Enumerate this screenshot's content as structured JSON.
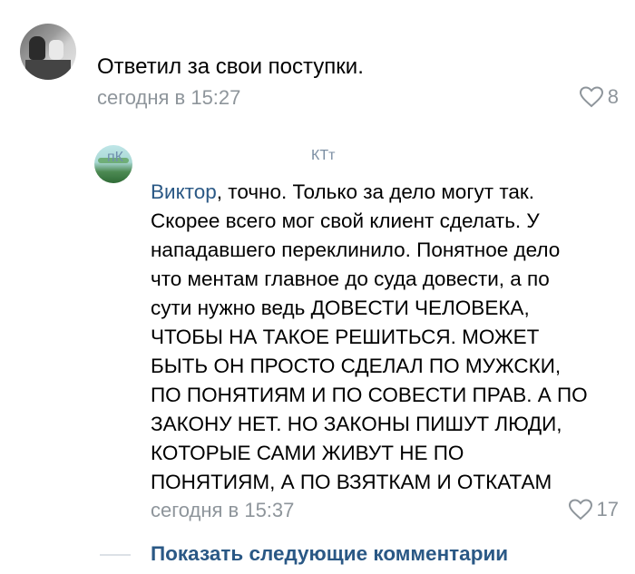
{
  "comment": {
    "text": "Ответил за свои поступки.",
    "timestamp": "сегодня в 15:27",
    "likes": "8"
  },
  "reply": {
    "header_fragment_left": "пК",
    "header_fragment_right": "КТт",
    "mention": "Виктор",
    "lines": [
      ", точно. Только за дело могут так.",
      "Скорее всего мог свой клиент сделать. У",
      "нападавшего переклинило. Понятное дело",
      "что ментам главное до суда довести, а по",
      "сути нужно ведь ДОВЕСТИ ЧЕЛОВЕКА,",
      "ЧТОБЫ НА ТАКОЕ РЕШИТЬСЯ. МОЖЕТ",
      "БЫТЬ ОН ПРОСТО СДЕЛАЛ ПО МУЖСКИ,",
      "ПО ПОНЯТИЯМ И ПО СОВЕСТИ ПРАВ. А ПО",
      "ЗАКОНУ НЕТ. НО ЗАКОНЫ ПИШУТ ЛЮДИ,",
      "КОТОРЫЕ САМИ ЖИВУТ НЕ ПО",
      "ПОНЯТИЯМ, А ПО ВЗЯТКАМ И ОТКАТАМ"
    ],
    "timestamp": "сегодня в 15:37",
    "likes": "17"
  },
  "show_more": "Показать следующие комментарии",
  "colors": {
    "link": "#2a5885",
    "meta": "#8e959b"
  },
  "icons": {
    "like": "heart-outline-icon"
  }
}
